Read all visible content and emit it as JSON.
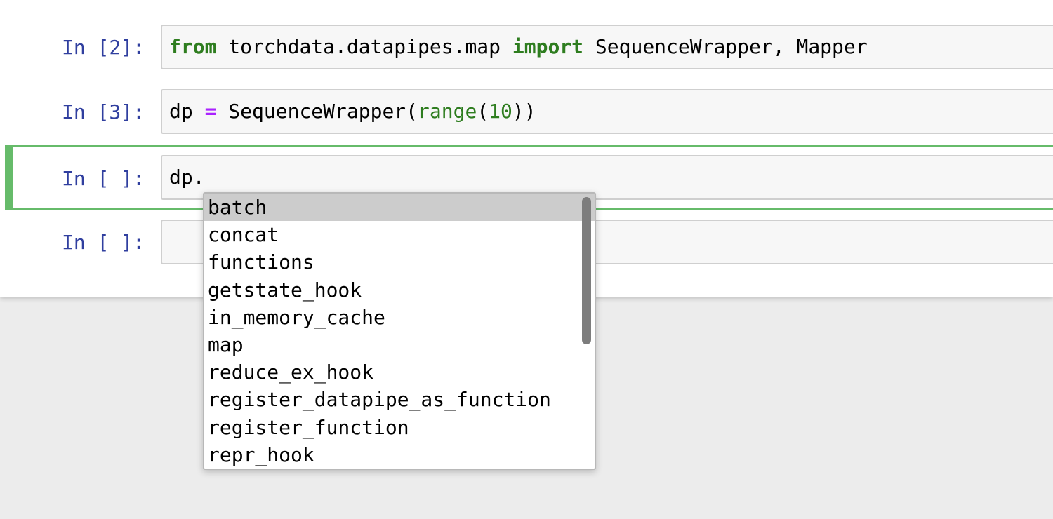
{
  "cells": [
    {
      "prompt": "In [2]:",
      "code": {
        "kw1": "from",
        "t1": " torchdata.datapipes.map ",
        "kw2": "import",
        "t2": " SequenceWrapper, Mapper"
      }
    },
    {
      "prompt": "In [3]:",
      "code": {
        "t1": "dp ",
        "op": "=",
        "t2": " SequenceWrapper(",
        "bi": "range",
        "p1": "(",
        "num": "10",
        "p2": "))"
      }
    },
    {
      "prompt": "In [ ]:",
      "code": {
        "t1": "dp."
      }
    },
    {
      "prompt": "In [ ]:",
      "code": {
        "t1": ""
      }
    }
  ],
  "completer": {
    "items": [
      "batch",
      "concat",
      "functions",
      "getstate_hook",
      "in_memory_cache",
      "map",
      "reduce_ex_hook",
      "register_datapipe_as_function",
      "register_function",
      "repr_hook"
    ],
    "selected_index": 0
  },
  "colors": {
    "prompt": "#303f9f",
    "keyword": "#2e7d1f",
    "operator": "#aa22ff",
    "selected_cell_border": "#66bb6a"
  }
}
